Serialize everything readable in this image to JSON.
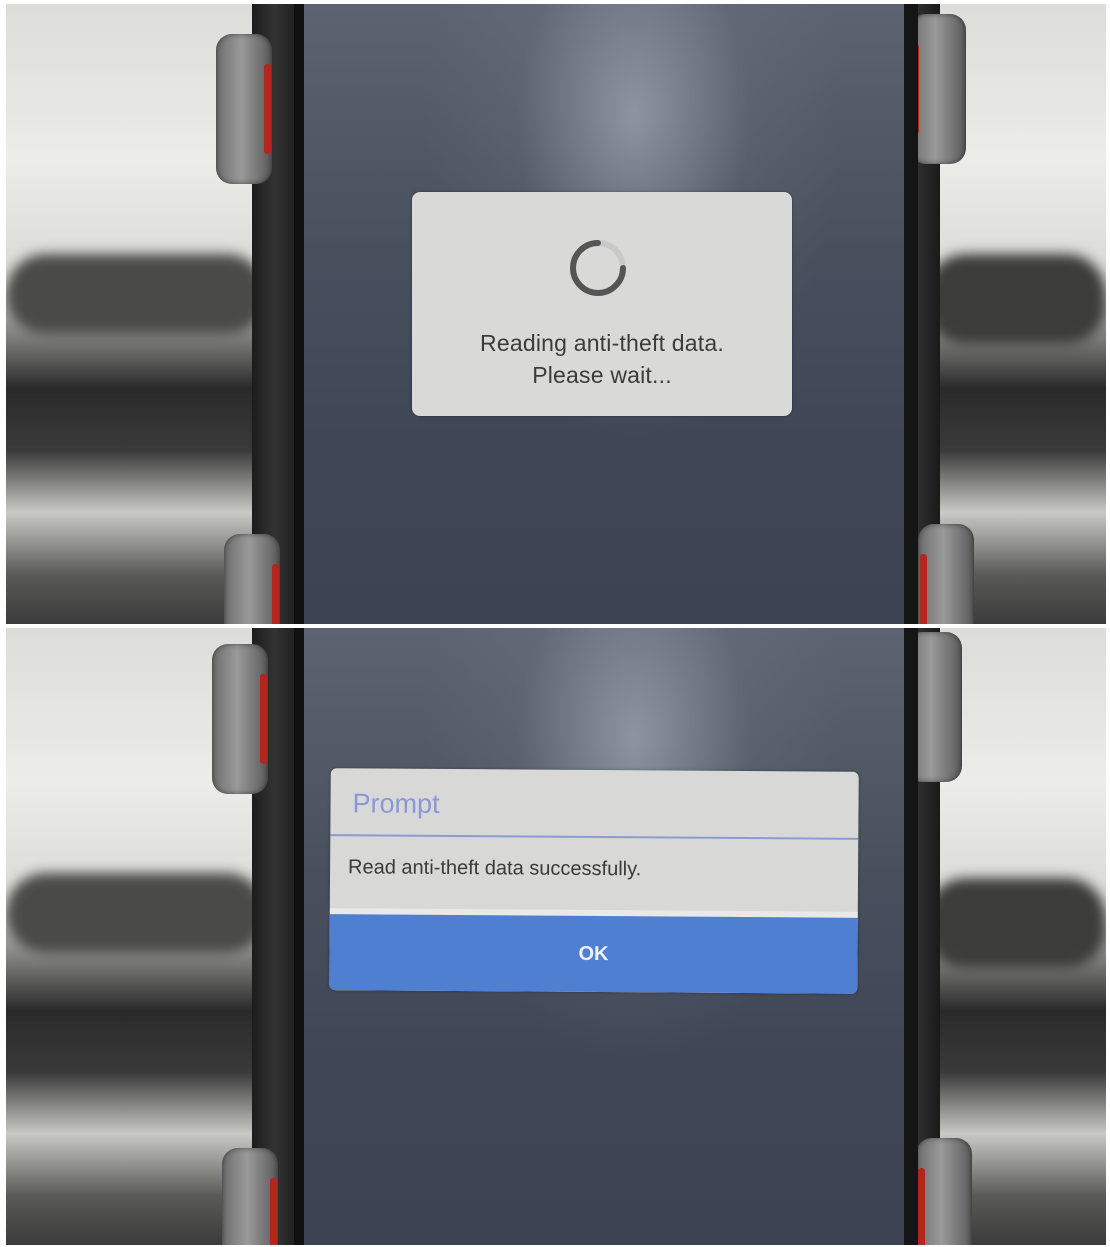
{
  "loading_dialog": {
    "line1": "Reading anti-theft data.",
    "line2": "Please wait...",
    "icon": "loading-spinner"
  },
  "prompt_dialog": {
    "title": "Prompt",
    "message": "Read anti-theft data successfully.",
    "ok_label": "OK"
  },
  "colors": {
    "dialog_bg": "#d9d9d7",
    "title_accent": "#8a97d8",
    "ok_button": "#4f7fd1",
    "screen_bg": "#48505e"
  }
}
